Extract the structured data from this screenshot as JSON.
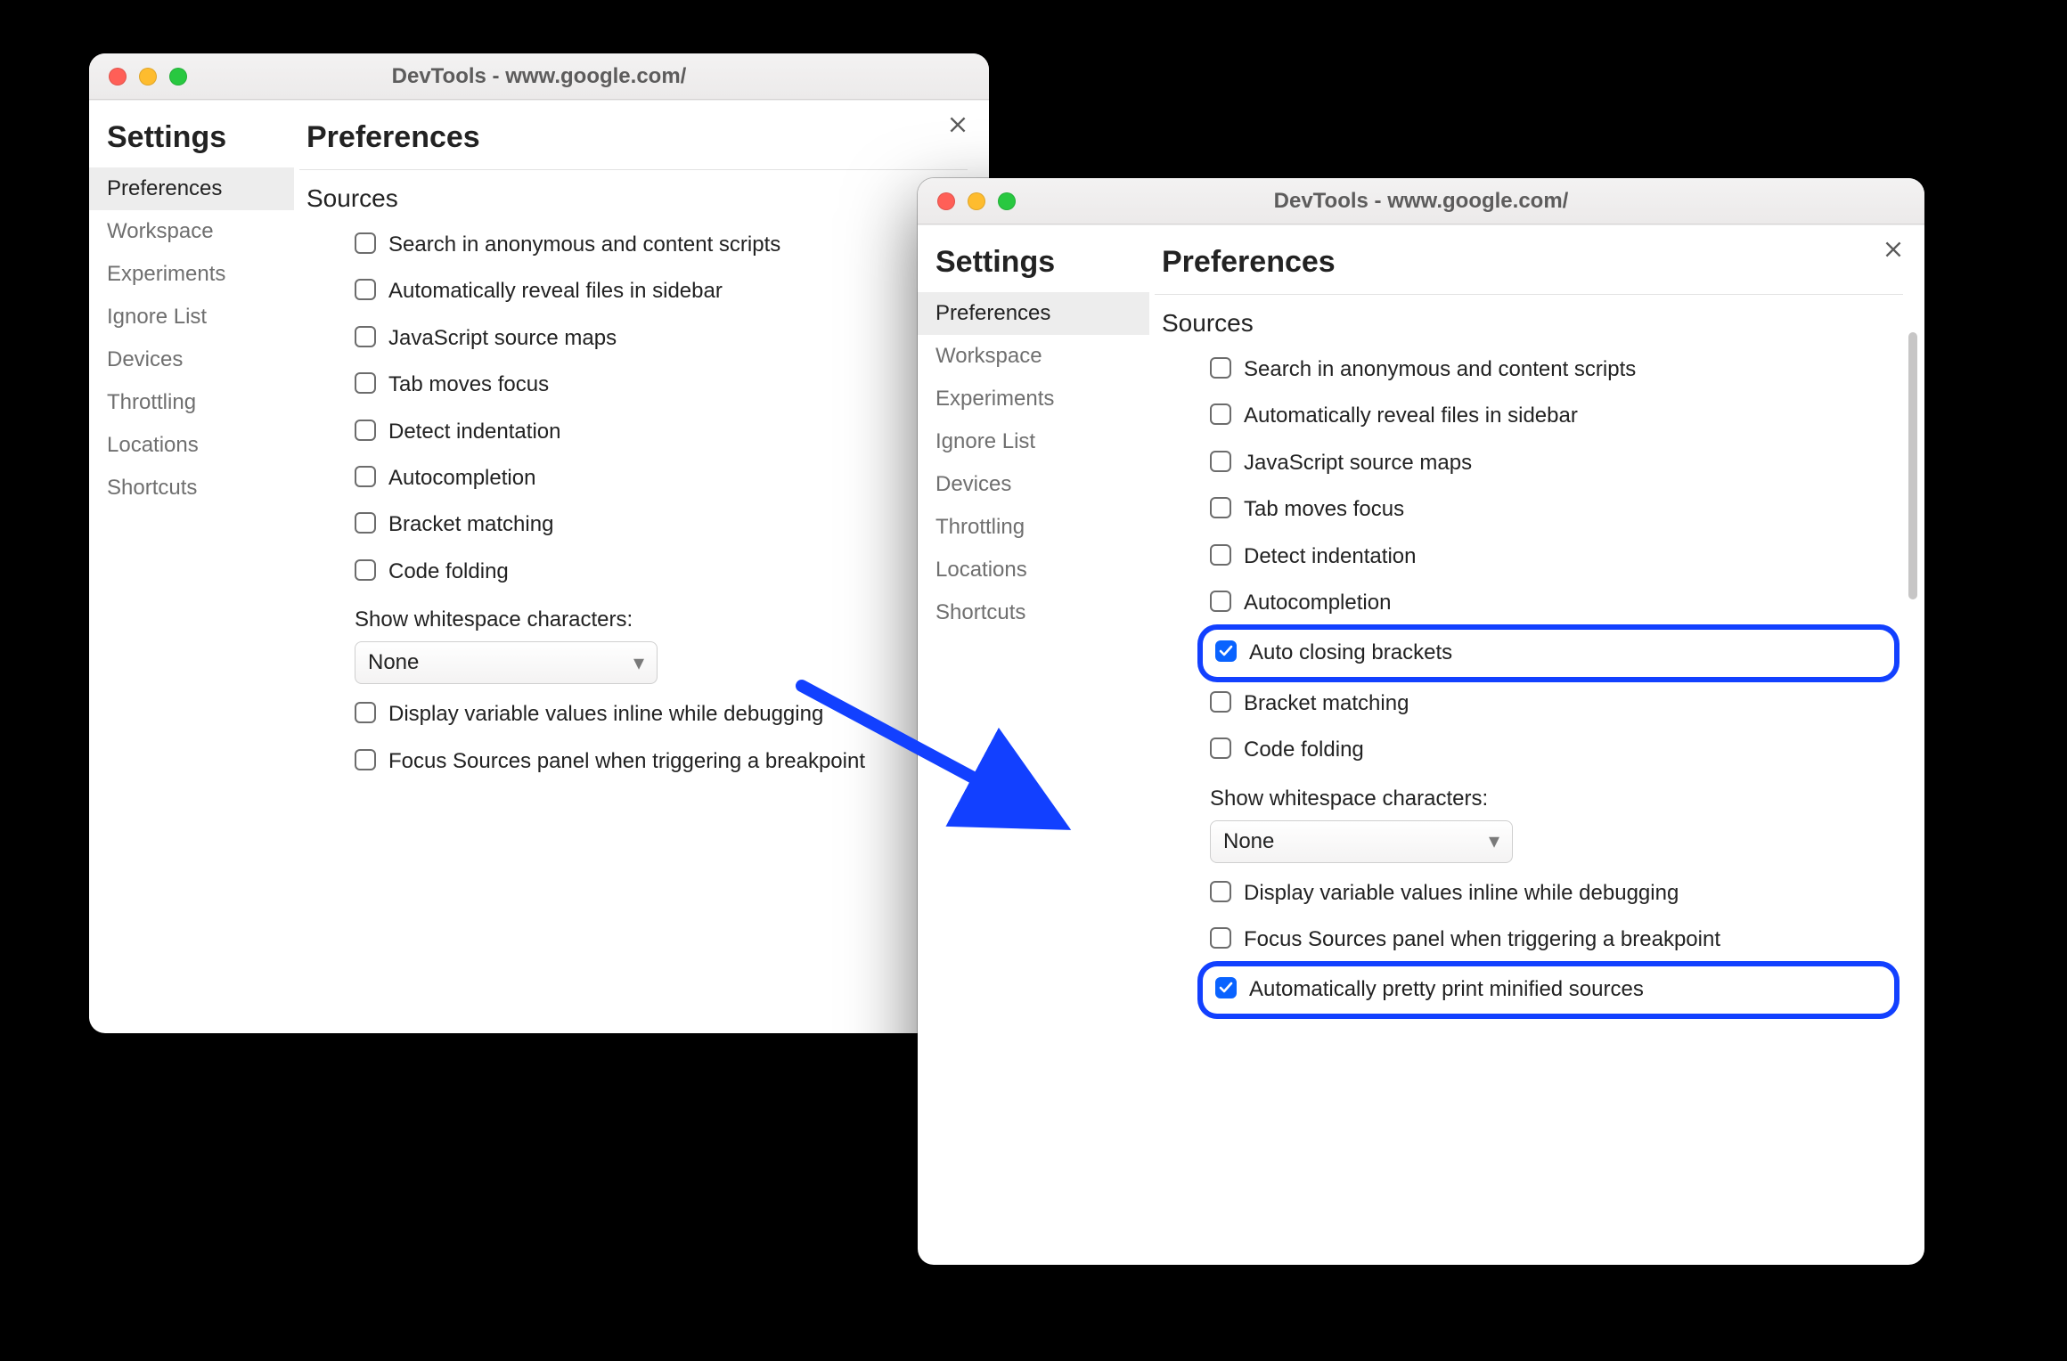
{
  "colors": {
    "accent": "#0a63ff",
    "highlight_ring": "#1240ff"
  },
  "window1": {
    "title": "DevTools - www.google.com/",
    "sidebar": {
      "title": "Settings",
      "items": [
        {
          "label": "Preferences",
          "selected": true
        },
        {
          "label": "Workspace",
          "selected": false
        },
        {
          "label": "Experiments",
          "selected": false
        },
        {
          "label": "Ignore List",
          "selected": false
        },
        {
          "label": "Devices",
          "selected": false
        },
        {
          "label": "Throttling",
          "selected": false
        },
        {
          "label": "Locations",
          "selected": false
        },
        {
          "label": "Shortcuts",
          "selected": false
        }
      ]
    },
    "main": {
      "title": "Preferences",
      "section": "Sources",
      "options": [
        {
          "label": "Search in anonymous and content scripts",
          "checked": false
        },
        {
          "label": "Automatically reveal files in sidebar",
          "checked": false
        },
        {
          "label": "JavaScript source maps",
          "checked": false
        },
        {
          "label": "Tab moves focus",
          "checked": false
        },
        {
          "label": "Detect indentation",
          "checked": false
        },
        {
          "label": "Autocompletion",
          "checked": false
        },
        {
          "label": "Bracket matching",
          "checked": false
        },
        {
          "label": "Code folding",
          "checked": false
        }
      ],
      "whitespace_label": "Show whitespace characters:",
      "whitespace_value": "None",
      "options2": [
        {
          "label": "Display variable values inline while debugging",
          "checked": false
        },
        {
          "label": "Focus Sources panel when triggering a breakpoint",
          "checked": false
        }
      ]
    }
  },
  "window2": {
    "title": "DevTools - www.google.com/",
    "sidebar": {
      "title": "Settings",
      "items": [
        {
          "label": "Preferences",
          "selected": true
        },
        {
          "label": "Workspace",
          "selected": false
        },
        {
          "label": "Experiments",
          "selected": false
        },
        {
          "label": "Ignore List",
          "selected": false
        },
        {
          "label": "Devices",
          "selected": false
        },
        {
          "label": "Throttling",
          "selected": false
        },
        {
          "label": "Locations",
          "selected": false
        },
        {
          "label": "Shortcuts",
          "selected": false
        }
      ]
    },
    "main": {
      "title": "Preferences",
      "section": "Sources",
      "options": [
        {
          "label": "Search in anonymous and content scripts",
          "checked": false,
          "highlight": false
        },
        {
          "label": "Automatically reveal files in sidebar",
          "checked": false,
          "highlight": false
        },
        {
          "label": "JavaScript source maps",
          "checked": false,
          "highlight": false
        },
        {
          "label": "Tab moves focus",
          "checked": false,
          "highlight": false
        },
        {
          "label": "Detect indentation",
          "checked": false,
          "highlight": false
        },
        {
          "label": "Autocompletion",
          "checked": false,
          "highlight": false
        },
        {
          "label": "Auto closing brackets",
          "checked": true,
          "highlight": true
        },
        {
          "label": "Bracket matching",
          "checked": false,
          "highlight": false
        },
        {
          "label": "Code folding",
          "checked": false,
          "highlight": false
        }
      ],
      "whitespace_label": "Show whitespace characters:",
      "whitespace_value": "None",
      "options2": [
        {
          "label": "Display variable values inline while debugging",
          "checked": false,
          "highlight": false
        },
        {
          "label": "Focus Sources panel when triggering a breakpoint",
          "checked": false,
          "highlight": false
        },
        {
          "label": "Automatically pretty print minified sources",
          "checked": true,
          "highlight": true
        }
      ]
    }
  }
}
